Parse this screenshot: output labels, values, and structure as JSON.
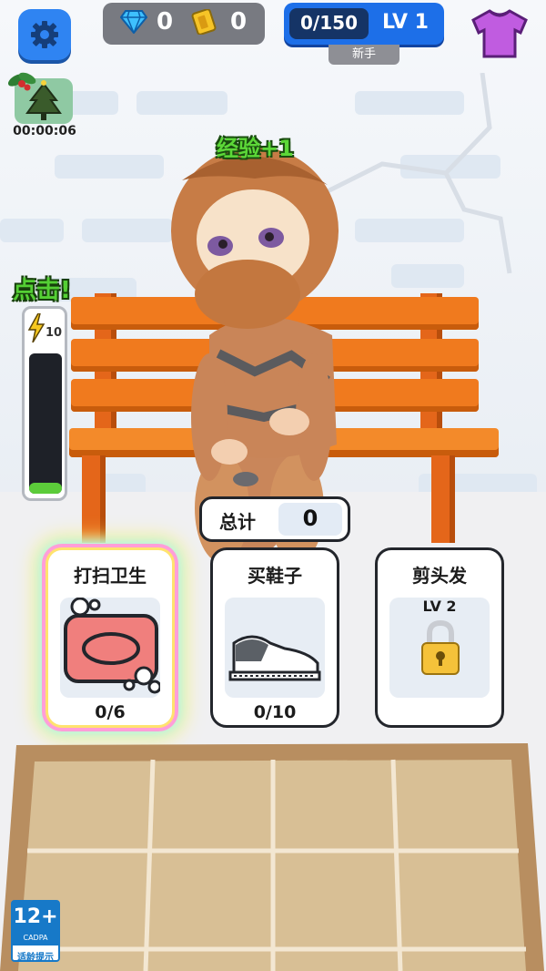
{
  "hud": {
    "gems": "0",
    "tickets": "0",
    "xp": "0/150",
    "level": "LV 1",
    "rank": "新手"
  },
  "event": {
    "timer": "00:00:06",
    "icon": "christmas-tree-icon"
  },
  "float_text": "经验+1",
  "energy": {
    "label": "点击!",
    "max": "10",
    "fill_fraction": 0.08
  },
  "total": {
    "label": "总计",
    "value": "0"
  },
  "cards": [
    {
      "title": "打扫卫生",
      "progress": "0/6",
      "icon": "soap-icon",
      "highlighted": true
    },
    {
      "title": "买鞋子",
      "progress": "0/10",
      "icon": "sneaker-icon",
      "highlighted": false
    },
    {
      "title": "剪头发",
      "level": "LV 2",
      "icon": "padlock-icon",
      "locked": true
    }
  ],
  "age_rating": {
    "number": "12+",
    "org": "CADPA",
    "note": "适龄提示"
  },
  "colors": {
    "accent_blue": "#2f84f2",
    "bench_orange": "#f07a1e",
    "xp_green": "#5cd838"
  }
}
